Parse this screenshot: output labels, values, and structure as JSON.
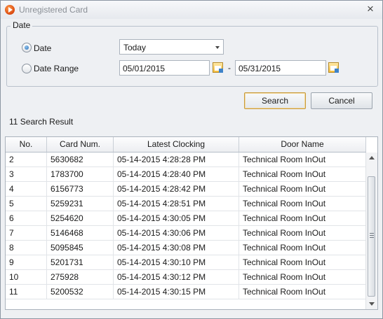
{
  "window": {
    "title": "Unregistered Card",
    "close_label": "×"
  },
  "date_group": {
    "label": "Date",
    "option_date": "Date",
    "option_range": "Date Range",
    "selected": "Date",
    "date_combo_value": "Today",
    "range_from": "05/01/2015",
    "range_separator": "-",
    "range_to": "05/31/2015"
  },
  "buttons": {
    "search": "Search",
    "cancel": "Cancel"
  },
  "result_count": "11 Search Result",
  "table": {
    "headers": [
      "No.",
      "Card Num.",
      "Latest Clocking",
      "Door Name"
    ],
    "rows": [
      [
        "2",
        "5630682",
        "05-14-2015 4:28:28 PM",
        "Technical Room InOut"
      ],
      [
        "3",
        "1783700",
        "05-14-2015 4:28:40 PM",
        "Technical Room InOut"
      ],
      [
        "4",
        "6156773",
        "05-14-2015 4:28:42 PM",
        "Technical Room InOut"
      ],
      [
        "5",
        "5259231",
        "05-14-2015 4:28:51 PM",
        "Technical Room InOut"
      ],
      [
        "6",
        "5254620",
        "05-14-2015 4:30:05 PM",
        "Technical Room InOut"
      ],
      [
        "7",
        "5146468",
        "05-14-2015 4:30:06 PM",
        "Technical Room InOut"
      ],
      [
        "8",
        "5095845",
        "05-14-2015 4:30:08 PM",
        "Technical Room InOut"
      ],
      [
        "9",
        "5201731",
        "05-14-2015 4:30:10 PM",
        "Technical Room InOut"
      ],
      [
        "10",
        "275928",
        "05-14-2015 4:30:12 PM",
        "Technical Room InOut"
      ],
      [
        "11",
        "5200532",
        "05-14-2015 4:30:15 PM",
        "Technical Room InOut"
      ]
    ]
  },
  "icons": {
    "app": "app-orange-play-icon",
    "close": "close-icon",
    "calendar": "calendar-icon",
    "dropdown": "chevron-down-icon"
  }
}
